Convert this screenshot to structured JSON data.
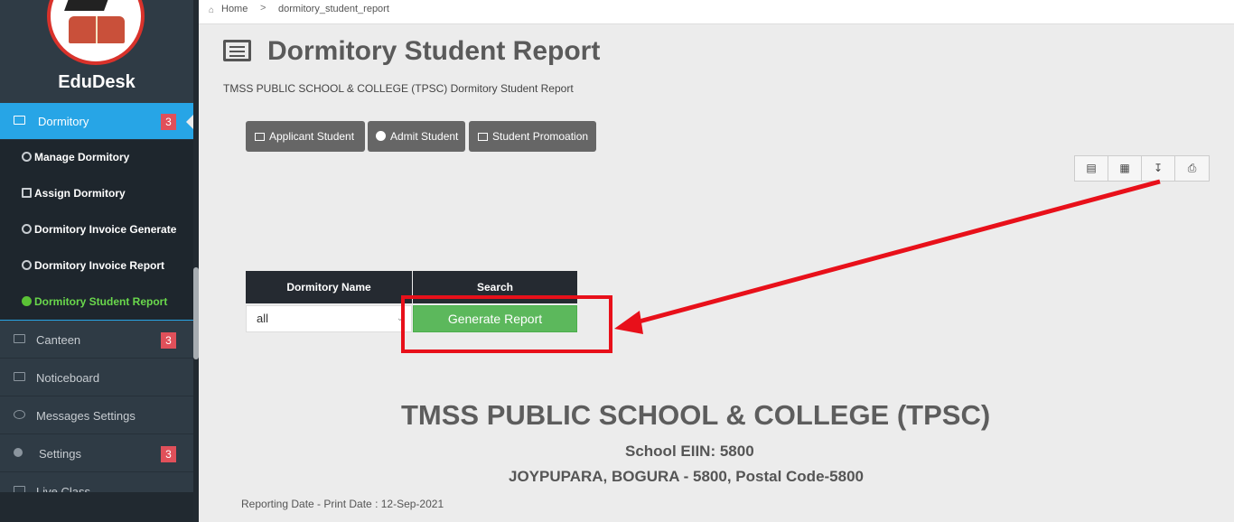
{
  "brand": "EduDesk",
  "breadcrumb": {
    "home": "Home",
    "separator": ">",
    "current": "dormitory_student_report"
  },
  "sidebar": {
    "active": {
      "label": "Dormitory",
      "badge": "3"
    },
    "submenu": [
      {
        "label": "Manage Dormitory"
      },
      {
        "label": "Assign Dormitory"
      },
      {
        "label": "Dormitory Invoice Generate"
      },
      {
        "label": "Dormitory Invoice Report"
      },
      {
        "label": "Dormitory Student Report"
      }
    ],
    "items": [
      {
        "label": "Canteen",
        "badge": "3"
      },
      {
        "label": "Noticeboard",
        "badge": ""
      },
      {
        "label": "Messages Settings",
        "badge": ""
      },
      {
        "label": "Settings",
        "badge": "3"
      },
      {
        "label": "Live Class",
        "badge": ""
      }
    ]
  },
  "page": {
    "title": "Dormitory Student Report",
    "subtitle": "TMSS PUBLIC SCHOOL & COLLEGE (TPSC) Dormitory Student Report"
  },
  "toolbar": {
    "applicant": "Applicant Student",
    "admit": "Admit Student",
    "promotion": "Student Promoation"
  },
  "export": {
    "pdf": "pdf-icon",
    "excel": "excel-icon",
    "download": "download-icon",
    "print": "print-icon"
  },
  "form": {
    "header_name": "Dormitory Name",
    "header_search": "Search",
    "dormitory_value": "all",
    "generate_label": "Generate Report"
  },
  "report": {
    "school_name": "TMSS PUBLIC SCHOOL & COLLEGE (TPSC)",
    "eiin": "School EIIN: 5800",
    "address": "JOYPUPARA, BOGURA - 5800, Postal Code-5800",
    "date_line": "Reporting Date - Print Date : 12-Sep-2021"
  },
  "colors": {
    "accent": "#27a5e6",
    "sidebar": "#2f3b45",
    "success": "#5cb85c",
    "highlight": "#e8101a",
    "badge": "#e0505a"
  }
}
